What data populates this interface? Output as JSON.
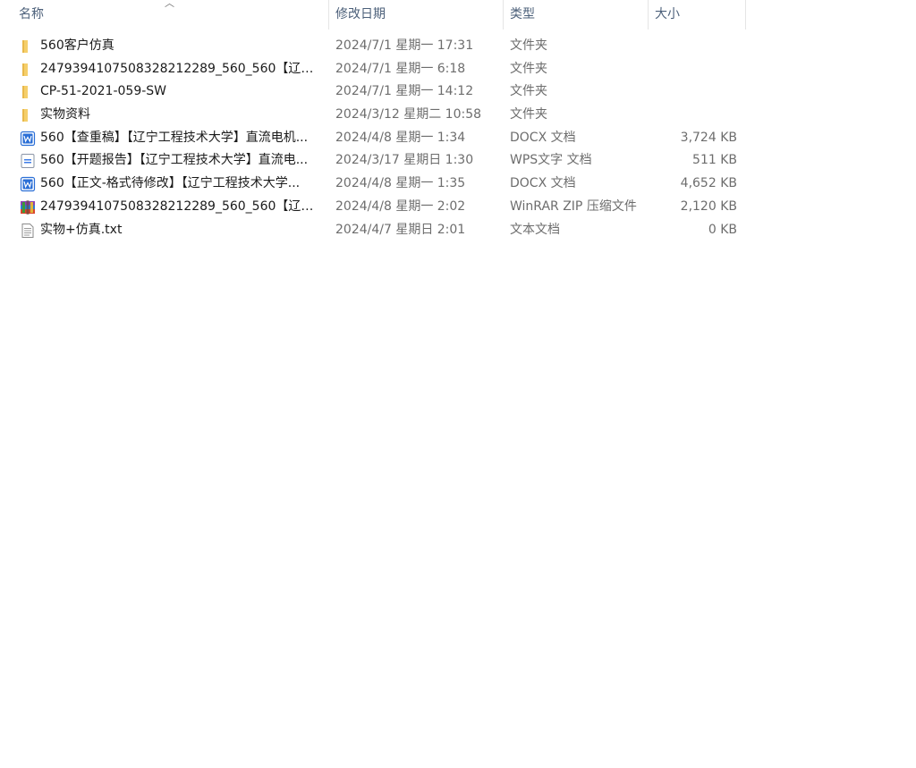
{
  "columns": {
    "name": "名称",
    "date": "修改日期",
    "type": "类型",
    "size": "大小"
  },
  "sort_indicator": "^",
  "files": [
    {
      "icon": "folder-icon",
      "name": "560客户仿真",
      "date": "2024/7/1 星期一 17:31",
      "type": "文件夹",
      "size": ""
    },
    {
      "icon": "folder-icon",
      "name": "2479394107508328212289_560_560【辽宁...",
      "date": "2024/7/1 星期一 6:18",
      "type": "文件夹",
      "size": ""
    },
    {
      "icon": "folder-icon",
      "name": "CP-51-2021-059-SW",
      "date": "2024/7/1 星期一 14:12",
      "type": "文件夹",
      "size": ""
    },
    {
      "icon": "folder-icon",
      "name": "实物资料",
      "date": "2024/3/12 星期二 10:58",
      "type": "文件夹",
      "size": ""
    },
    {
      "icon": "word-docx-icon",
      "name": "560【查重稿】【辽宁工程技术大学】直流电机...",
      "date": "2024/4/8 星期一 1:34",
      "type": "DOCX 文档",
      "size": "3,724 KB"
    },
    {
      "icon": "wps-document-icon",
      "name": "560【开题报告】【辽宁工程技术大学】直流电...",
      "date": "2024/3/17 星期日 1:30",
      "type": "WPS文字 文档",
      "size": "511 KB"
    },
    {
      "icon": "word-docx-icon",
      "name": "560【正文-格式待修改】【辽宁工程技术大学...",
      "date": "2024/4/8 星期一 1:35",
      "type": "DOCX 文档",
      "size": "4,652 KB"
    },
    {
      "icon": "winrar-archive-icon",
      "name": "2479394107508328212289_560_560【辽宁...",
      "date": "2024/4/8 星期一 2:02",
      "type": "WinRAR ZIP 压缩文件",
      "size": "2,120 KB"
    },
    {
      "icon": "text-file-icon",
      "name": "实物+仿真.txt",
      "date": "2024/4/7 星期日 2:01",
      "type": "文本文档",
      "size": "0 KB"
    }
  ],
  "colors": {
    "header_text": "#4c607a",
    "folder": "#f2c55c",
    "word_blue": "#2b6fd6",
    "muted_text": "#6d6d6d"
  }
}
